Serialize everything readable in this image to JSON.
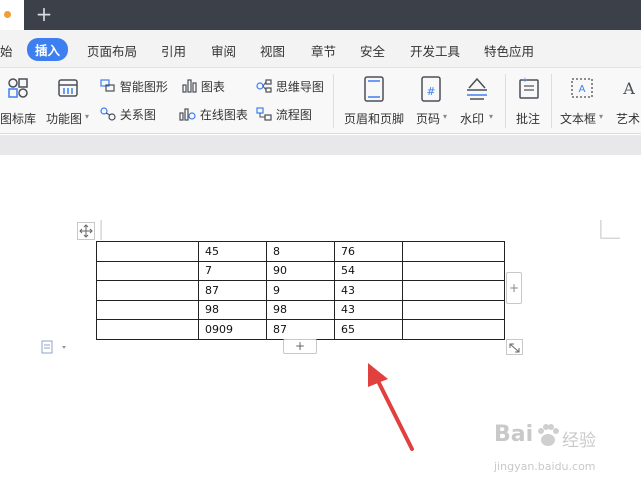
{
  "menu": {
    "items": [
      {
        "label": "始",
        "x": 0
      },
      {
        "label": "插入",
        "active": true
      },
      {
        "label": "页面布局"
      },
      {
        "label": "引用"
      },
      {
        "label": "审阅"
      },
      {
        "label": "视图"
      },
      {
        "label": "章节"
      },
      {
        "label": "安全"
      },
      {
        "label": "开发工具"
      },
      {
        "label": "特色应用"
      }
    ]
  },
  "ribbon": {
    "icon_library": "图标库",
    "function_chart": "功能图",
    "smart_shape": "智能图形",
    "chart": "图表",
    "mind_map": "思维导图",
    "relation_chart": "关系图",
    "online_chart": "在线图表",
    "flowchart": "流程图",
    "header_footer": "页眉和页脚",
    "page_number": "页码",
    "watermark": "水印",
    "comment": "批注",
    "textbox": "文本框",
    "art": "艺术"
  },
  "table": {
    "rows": [
      [
        "",
        "45",
        "8",
        "76",
        ""
      ],
      [
        "",
        "7",
        "90",
        "54",
        ""
      ],
      [
        "",
        "87",
        "9",
        "43",
        ""
      ],
      [
        "",
        "98",
        "98",
        "43",
        ""
      ],
      [
        "",
        "0909",
        "87",
        "65",
        ""
      ]
    ]
  },
  "controls": {
    "add_column": "+",
    "add_row": "+"
  },
  "watermark": {
    "brand": "Bai",
    "brand_cn": "经验",
    "url": "jingyan.baidu.com"
  },
  "colors": {
    "accent": "#3d7ff0",
    "titlebar": "#3c4048",
    "arrow": "#e0413f"
  }
}
